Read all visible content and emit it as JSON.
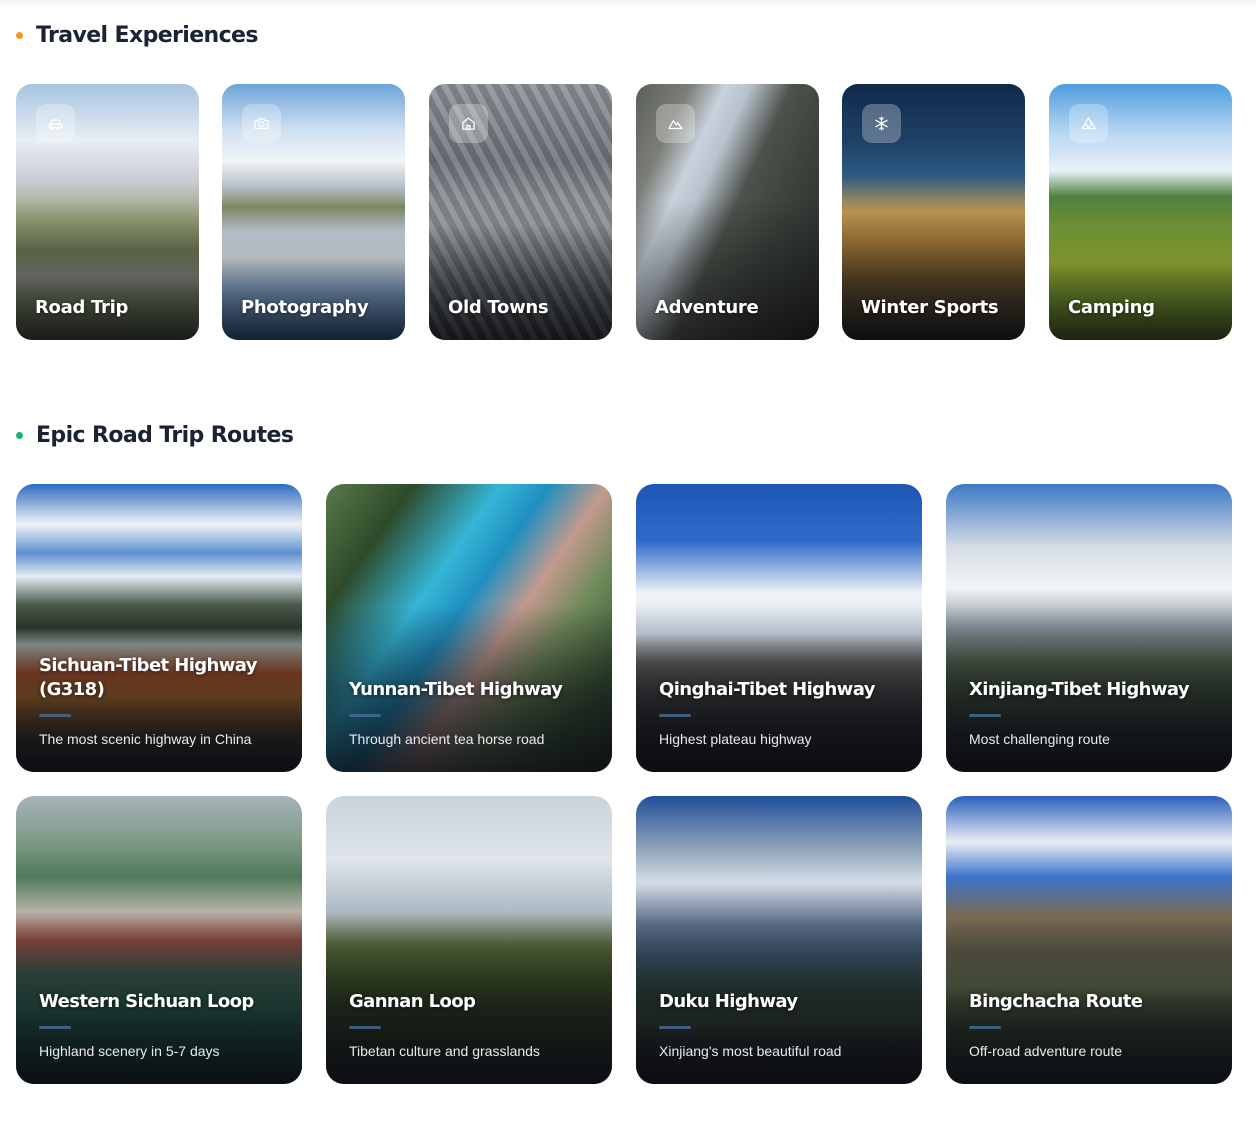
{
  "sections": {
    "experiences": {
      "title": "Travel Experiences",
      "dot_color": "#f29a1f"
    },
    "routes": {
      "title": "Epic Road Trip Routes",
      "dot_color": "#1bb36f"
    }
  },
  "experiences": [
    {
      "label": "Road Trip",
      "icon": "car-icon"
    },
    {
      "label": "Photography",
      "icon": "camera-icon"
    },
    {
      "label": "Old Towns",
      "icon": "home-icon"
    },
    {
      "label": "Adventure",
      "icon": "mountain-icon"
    },
    {
      "label": "Winter Sports",
      "icon": "snowflake-icon"
    },
    {
      "label": "Camping",
      "icon": "tent-icon"
    }
  ],
  "routes": [
    {
      "title": "Sichuan-Tibet Highway (G318)",
      "description": "The most scenic highway in China"
    },
    {
      "title": "Yunnan-Tibet Highway",
      "description": "Through ancient tea horse road"
    },
    {
      "title": "Qinghai-Tibet Highway",
      "description": "Highest plateau highway"
    },
    {
      "title": "Xinjiang-Tibet Highway",
      "description": "Most challenging route"
    },
    {
      "title": "Western Sichuan Loop",
      "description": "Highland scenery in 5-7 days"
    },
    {
      "title": "Gannan Loop",
      "description": "Tibetan culture and grasslands"
    },
    {
      "title": "Duku Highway",
      "description": "Xinjiang's most beautiful road"
    },
    {
      "title": "Bingchacha Route",
      "description": "Off-road adventure route"
    }
  ]
}
